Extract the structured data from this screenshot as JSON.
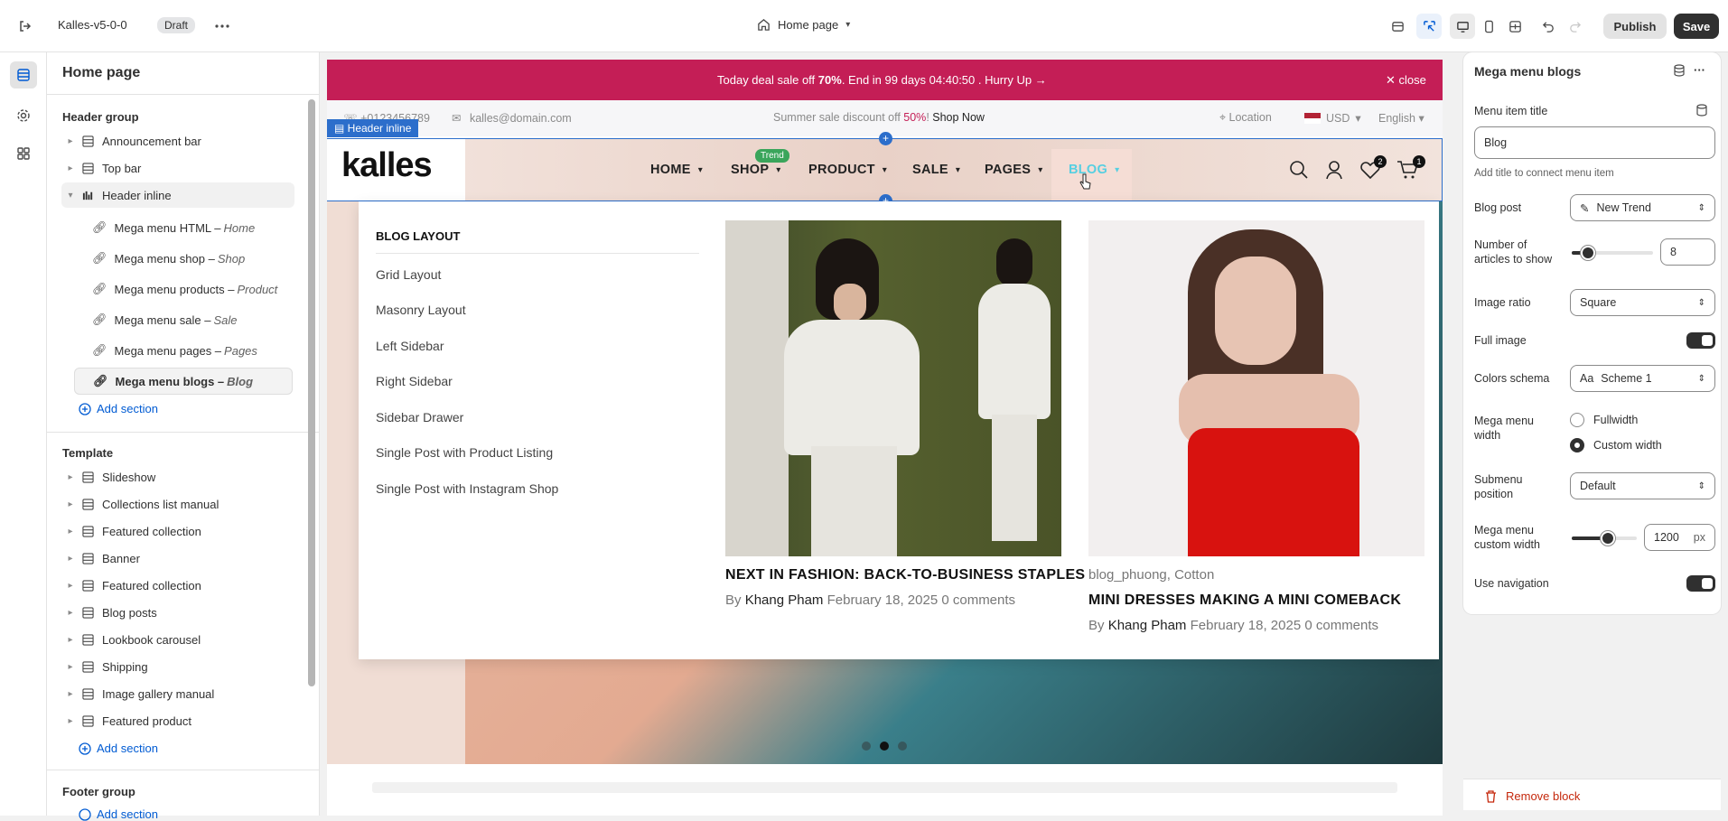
{
  "topbar": {
    "store_name": "Kalles-v5-0-0",
    "status_badge": "Draft",
    "page_selector": "Home page",
    "publish_label": "Publish",
    "save_label": "Save"
  },
  "sidebar": {
    "title": "Home page",
    "header_group": "Header group",
    "header_items": [
      {
        "label": "Announcement bar",
        "icon": "layout-icon"
      },
      {
        "label": "Top bar",
        "icon": "layout-icon"
      },
      {
        "label": "Header inline",
        "icon": "columns-icon"
      }
    ],
    "mega_items": [
      {
        "label": "Mega menu HTML –",
        "sub": "Home"
      },
      {
        "label": "Mega menu shop –",
        "sub": "Shop"
      },
      {
        "label": "Mega menu products –",
        "sub": "Product"
      },
      {
        "label": "Mega menu sale –",
        "sub": "Sale"
      },
      {
        "label": "Mega menu pages –",
        "sub": "Pages"
      },
      {
        "label": "Mega menu blogs –",
        "sub": "Blog"
      }
    ],
    "add_section": "Add section",
    "template_group": "Template",
    "template_items": [
      {
        "label": "Slideshow",
        "icon": "slideshow-icon"
      },
      {
        "label": "Collections list manual",
        "icon": "layout-icon"
      },
      {
        "label": "Featured collection",
        "icon": "layout-icon"
      },
      {
        "label": "Banner",
        "icon": "layout-icon"
      },
      {
        "label": "Featured collection",
        "icon": "layout-icon"
      },
      {
        "label": "Blog posts",
        "icon": "edit-icon"
      },
      {
        "label": "Lookbook carousel",
        "icon": "layout-icon"
      },
      {
        "label": "Shipping",
        "icon": "layout-icon"
      },
      {
        "label": "Image gallery manual",
        "icon": "gallery-icon"
      },
      {
        "label": "Featured product",
        "icon": "product-icon"
      }
    ],
    "footer_group": "Footer group",
    "footer_add": "Add section"
  },
  "site": {
    "announcement": {
      "text_pre": "Today deal sale off ",
      "text_bold": "70%",
      "text_post": ". End in 99 days 04:40:50 .  Hurry Up →",
      "close": "close"
    },
    "topbar": {
      "phone": "+0123456789",
      "email": "kalles@domain.com",
      "promo_pre": "Summer sale discount off ",
      "promo_pct": "50%",
      "promo_bang": "! ",
      "promo_link": "Shop Now",
      "location": "Location",
      "currency": "USD",
      "language": "English"
    },
    "header_tag": "Header inline",
    "logo": "kalles",
    "nav": [
      {
        "label": "HOME"
      },
      {
        "label": "SHOP"
      },
      {
        "label": "PRODUCT"
      },
      {
        "label": "SALE"
      },
      {
        "label": "PAGES"
      },
      {
        "label": "BLOG"
      }
    ],
    "trend_badge": "Trend",
    "wishlist_count": "2",
    "cart_count": "1",
    "mega": {
      "heading": "BLOG LAYOUT",
      "links": [
        "Grid Layout",
        "Masonry Layout",
        "Left Sidebar",
        "Right Sidebar",
        "Sidebar Drawer",
        "Single Post with Product Listing",
        "Single Post with Instagram Shop"
      ],
      "posts": [
        {
          "tags": "",
          "title": "NEXT IN FASHION: BACK-TO-BUSINESS STAPLES",
          "by": "By",
          "author": "Khang Pham",
          "date": "February 18, 2025",
          "comments": "0 comments"
        },
        {
          "tags": "blog_phuong, Cotton",
          "title": "MINI DRESSES MAKING A MINI COMEBACK",
          "by": "By",
          "author": "Khang Pham",
          "date": "February 18, 2025",
          "comments": "0 comments"
        }
      ]
    }
  },
  "panel": {
    "title": "Mega menu blogs",
    "menu_item_title_label": "Menu item title",
    "menu_item_title_value": "Blog",
    "menu_item_help": "Add title to connect menu item",
    "blog_post_label": "Blog post",
    "blog_post_value": "New Trend",
    "articles_label_1": "Number of",
    "articles_label_2": "articles to show",
    "articles_value": "8",
    "articles_fraction": 0.2,
    "image_ratio_label": "Image ratio",
    "image_ratio_value": "Square",
    "full_image_label": "Full image",
    "full_image_on": true,
    "colors_label": "Colors schema",
    "colors_value": "Scheme 1",
    "width_label_1": "Mega menu",
    "width_label_2": "width",
    "width_opt_1": "Fullwidth",
    "width_opt_2": "Custom width",
    "submenu_label_1": "Submenu",
    "submenu_label_2": "position",
    "submenu_value": "Default",
    "custom_width_label_1": "Mega menu",
    "custom_width_label_2": "custom width",
    "custom_width_value": "1200",
    "custom_width_unit": "px",
    "custom_width_fraction": 0.55,
    "use_nav_label": "Use navigation",
    "use_nav_on": true,
    "remove_block": "Remove block"
  },
  "colors": {
    "accent": "#c41e56",
    "blog_active": "#56cfe1",
    "trend": "#3aa55b",
    "link": "#005bd3",
    "remove": "#c5280c"
  }
}
